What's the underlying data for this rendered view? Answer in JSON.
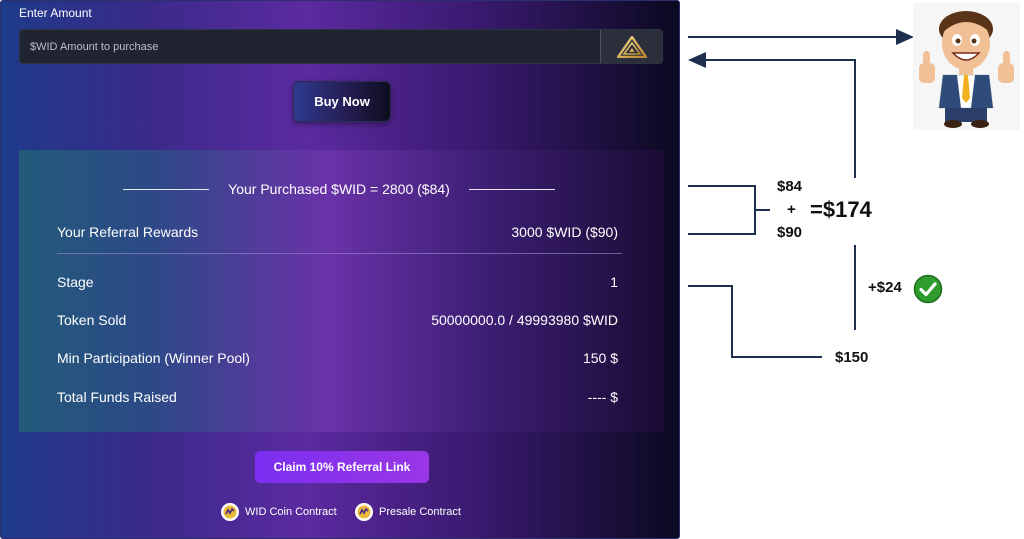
{
  "purchase": {
    "enter_amount_label": "Enter Amount",
    "amount_placeholder": "$WID Amount to purchase",
    "buy_button": "Buy Now"
  },
  "summary": {
    "purchased_text": "Your Purchased $WID = 2800 ($84)",
    "rows": [
      {
        "label": "Your Referral Rewards",
        "value": "3000 $WID ($90)"
      },
      {
        "label": "Stage",
        "value": "1"
      },
      {
        "label": "Token Sold",
        "value": "50000000.0 / 49993980 $WID"
      },
      {
        "label": "Min Participation (Winner Pool)",
        "value": "150 $"
      },
      {
        "label": "Total Funds Raised",
        "value": "---- $"
      }
    ]
  },
  "actions": {
    "claim_button": "Claim 10% Referral Link",
    "wid_contract": "WID Coin Contract",
    "presale_contract": "Presale Contract"
  },
  "annotation": {
    "purchased_amount": "$84",
    "plus_sign": "+",
    "referral_amount": "$90",
    "total": "=$174",
    "gain": "+$24",
    "min_participation": "$150"
  },
  "colors": {
    "arrow": "#1e2f4d",
    "claim_purple": "#8a32ec",
    "check_green": "#2e9d2e"
  },
  "icons": {
    "token_logo": "gold-triangle-icon",
    "contract_icon": "coin-icon",
    "check": "check-circle-icon",
    "mascot": "thumbs-up-mascot"
  }
}
